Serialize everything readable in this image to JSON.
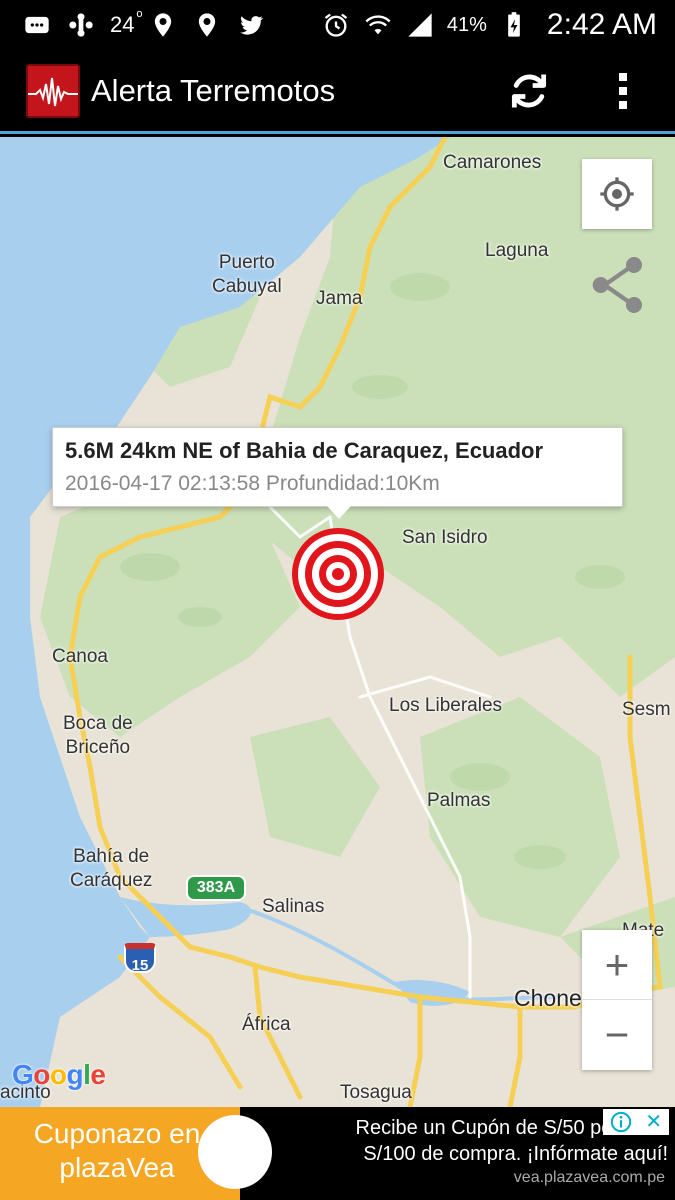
{
  "status_bar": {
    "notification_count": "24",
    "battery_percent": "41%",
    "time": "2:42 AM",
    "icons": [
      "messages-icon",
      "plus-icon",
      "location-pin-icon",
      "location-pin-icon",
      "twitter-icon",
      "alarm-icon",
      "wifi-icon",
      "signal-icon",
      "battery-charging-icon"
    ]
  },
  "app_bar": {
    "title": "Alerta Terremotos",
    "logo_icon": "seismograph-logo-icon",
    "actions": [
      "refresh-icon",
      "overflow-menu-icon"
    ]
  },
  "map": {
    "places": {
      "camarones": "Camarones",
      "laguna": "Laguna",
      "puerto_cabuyal_1": "Puerto",
      "puerto_cabuyal_2": "Cabuyal",
      "jama": "Jama",
      "san_isidro": "San Isidro",
      "canoa": "Canoa",
      "boca_1": "Boca de",
      "boca_2": "Briceño",
      "los_liberales": "Los Liberales",
      "sesm": "Sesm",
      "palmas": "Palmas",
      "bahia_1": "Bahía de",
      "bahia_2": "Caráquez",
      "salinas": "Salinas",
      "mate": "Mate",
      "chone": "Chone",
      "africa": "África",
      "tosagua": "Tosagua",
      "acinto": "acinto"
    },
    "road_shields": {
      "route_383a": "383A",
      "route_15": "15"
    },
    "controls": {
      "zoom_in": "+",
      "zoom_out": "−"
    },
    "google_logo": "Google"
  },
  "info_window": {
    "title": "5.6M  24km NE of Bahia de Caraquez, Ecuador",
    "subtitle": "2016-04-17 02:13:58 Profundidad:10Km"
  },
  "ad": {
    "left_line1": "Cuponazo en",
    "left_line2": "plazaVea",
    "right_line1": "Recibe un Cupón de S/50 por cada",
    "right_line2": "S/100 de compra. ¡Infórmate aquí!",
    "domain": "vea.plazavea.com.pe",
    "choices_icon": "adchoices-icon",
    "close_label": "✕"
  },
  "colors": {
    "water": "#a9cfef",
    "land": "#e8e3d6",
    "forest": "#c8dfb6",
    "road_yellow": "#f6cf55",
    "marker_red": "#e1161c",
    "appbar_accent": "#4fa3d8",
    "ad_orange": "#f5a623"
  }
}
